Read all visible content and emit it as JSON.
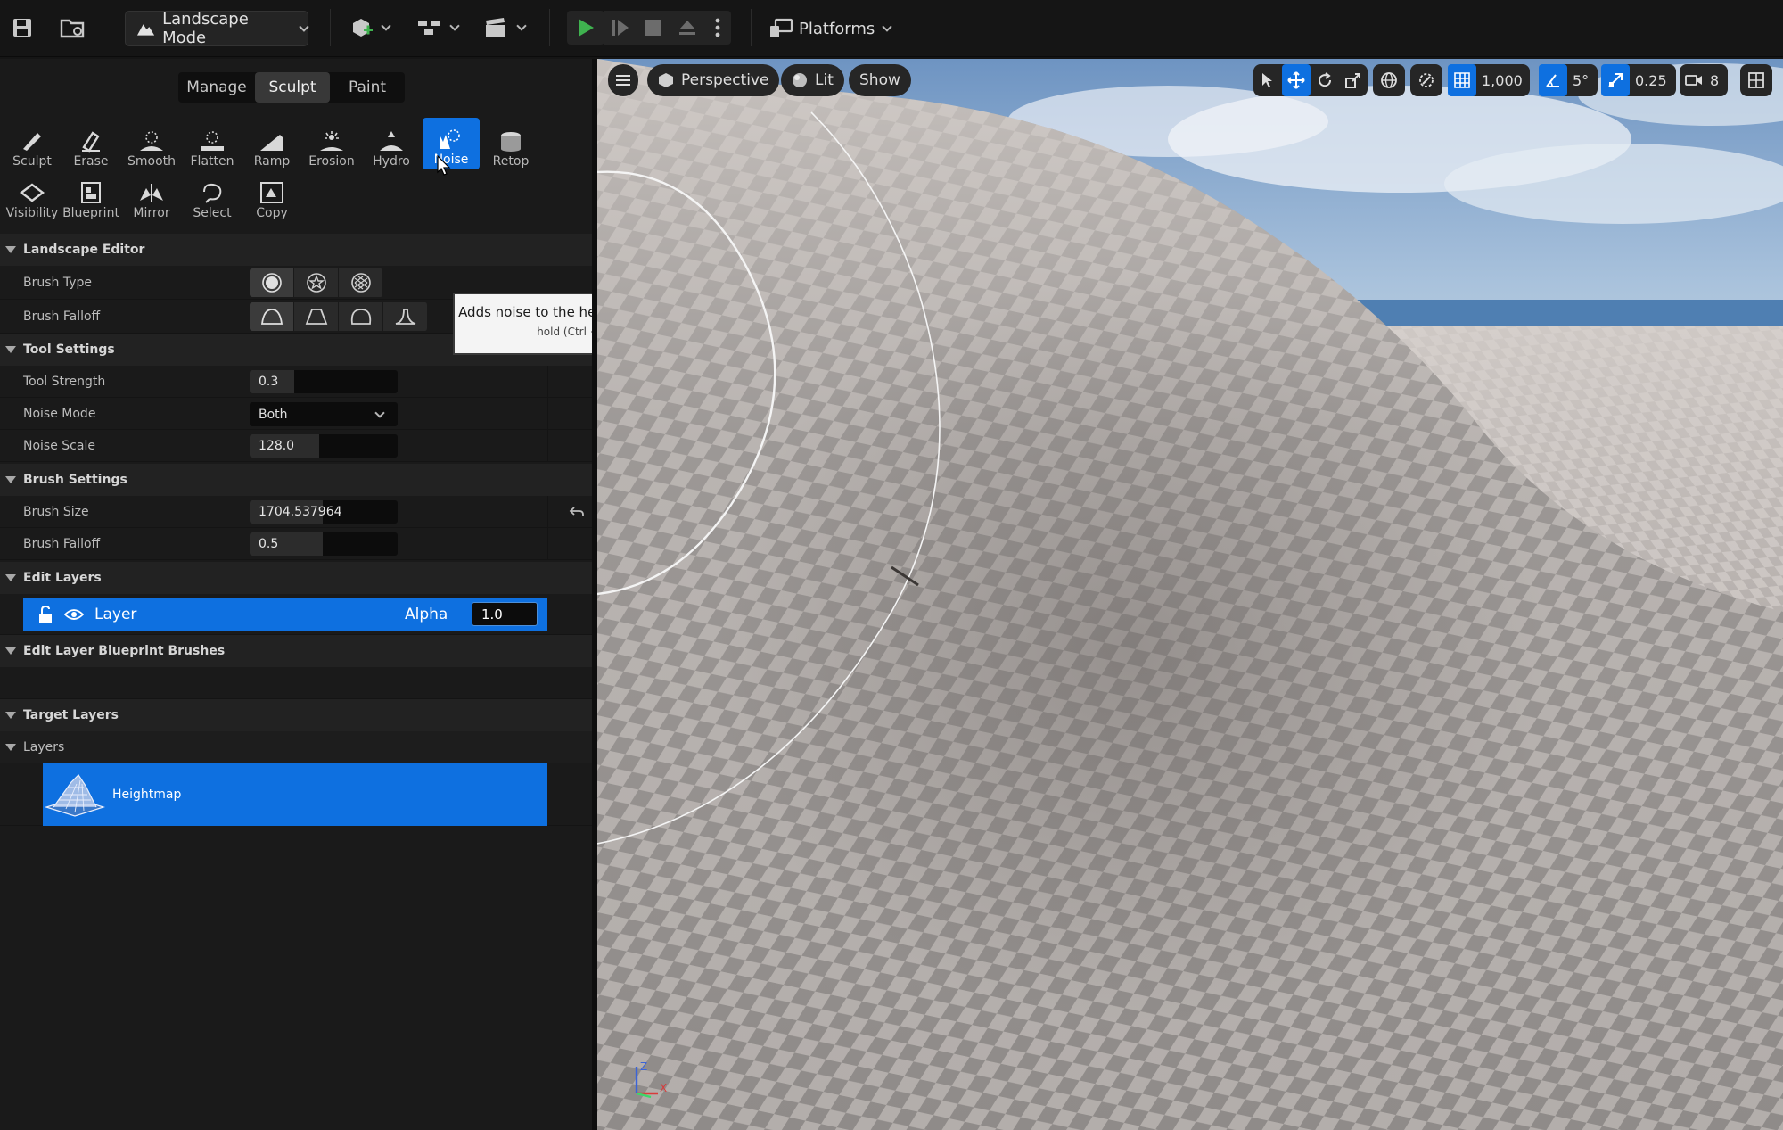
{
  "toolbar": {
    "mode_label": "Landscape Mode",
    "platforms_label": "Platforms"
  },
  "mode_tabs": [
    {
      "label": "Manage",
      "active": false
    },
    {
      "label": "Sculpt",
      "active": true
    },
    {
      "label": "Paint",
      "active": false
    }
  ],
  "tools": [
    {
      "label": "Sculpt",
      "icon": "sculpt-icon"
    },
    {
      "label": "Erase",
      "icon": "erase-icon"
    },
    {
      "label": "Smooth",
      "icon": "smooth-icon"
    },
    {
      "label": "Flatten",
      "icon": "flatten-icon"
    },
    {
      "label": "Ramp",
      "icon": "ramp-icon"
    },
    {
      "label": "Erosion",
      "icon": "erosion-icon"
    },
    {
      "label": "Hydro",
      "icon": "hydro-icon"
    },
    {
      "label": "Noise",
      "icon": "noise-icon",
      "active": true
    },
    {
      "label": "Retop",
      "icon": "retop-icon"
    },
    {
      "label": "Visibility",
      "icon": "visibility-icon"
    },
    {
      "label": "Blueprint",
      "icon": "blueprint-icon"
    },
    {
      "label": "Mirror",
      "icon": "mirror-icon"
    },
    {
      "label": "Select",
      "icon": "select-icon"
    },
    {
      "label": "Copy",
      "icon": "copy-icon"
    }
  ],
  "tooltip": {
    "title": "Adds noise to the heightmap or blend layer",
    "hint": "hold (Ctrl + Alt) for more"
  },
  "sections": {
    "landscape_editor": "Landscape Editor",
    "tool_settings": "Tool Settings",
    "brush_settings": "Brush Settings",
    "edit_layers": "Edit Layers",
    "edit_layer_blueprint_brushes": "Edit Layer Blueprint Brushes",
    "target_layers": "Target Layers",
    "layers": "Layers"
  },
  "properties": {
    "brush_type_label": "Brush Type",
    "brush_falloff_shape_label": "Brush Falloff",
    "tool_strength_label": "Tool Strength",
    "tool_strength_value": "0.3",
    "noise_mode_label": "Noise Mode",
    "noise_mode_value": "Both",
    "noise_scale_label": "Noise Scale",
    "noise_scale_value": "128.0",
    "brush_size_label": "Brush Size",
    "brush_size_value": "1704.537964",
    "brush_falloff_label": "Brush Falloff",
    "brush_falloff_value": "0.5"
  },
  "edit_layers": {
    "layer_name": "Layer",
    "alpha_label": "Alpha",
    "alpha_value": "1.0"
  },
  "target_layers": {
    "heightmap_label": "Heightmap"
  },
  "viewport": {
    "perspective_label": "Perspective",
    "lit_label": "Lit",
    "show_label": "Show",
    "grid_size": "1,000",
    "rotation_snap": "5°",
    "scale_snap": "0.25",
    "camera_speed": "8"
  },
  "colors": {
    "accent": "#0e70e0",
    "panel_bg": "#1a1a1a",
    "toolbar_bg": "#151515",
    "play_green": "#3fb24f"
  }
}
